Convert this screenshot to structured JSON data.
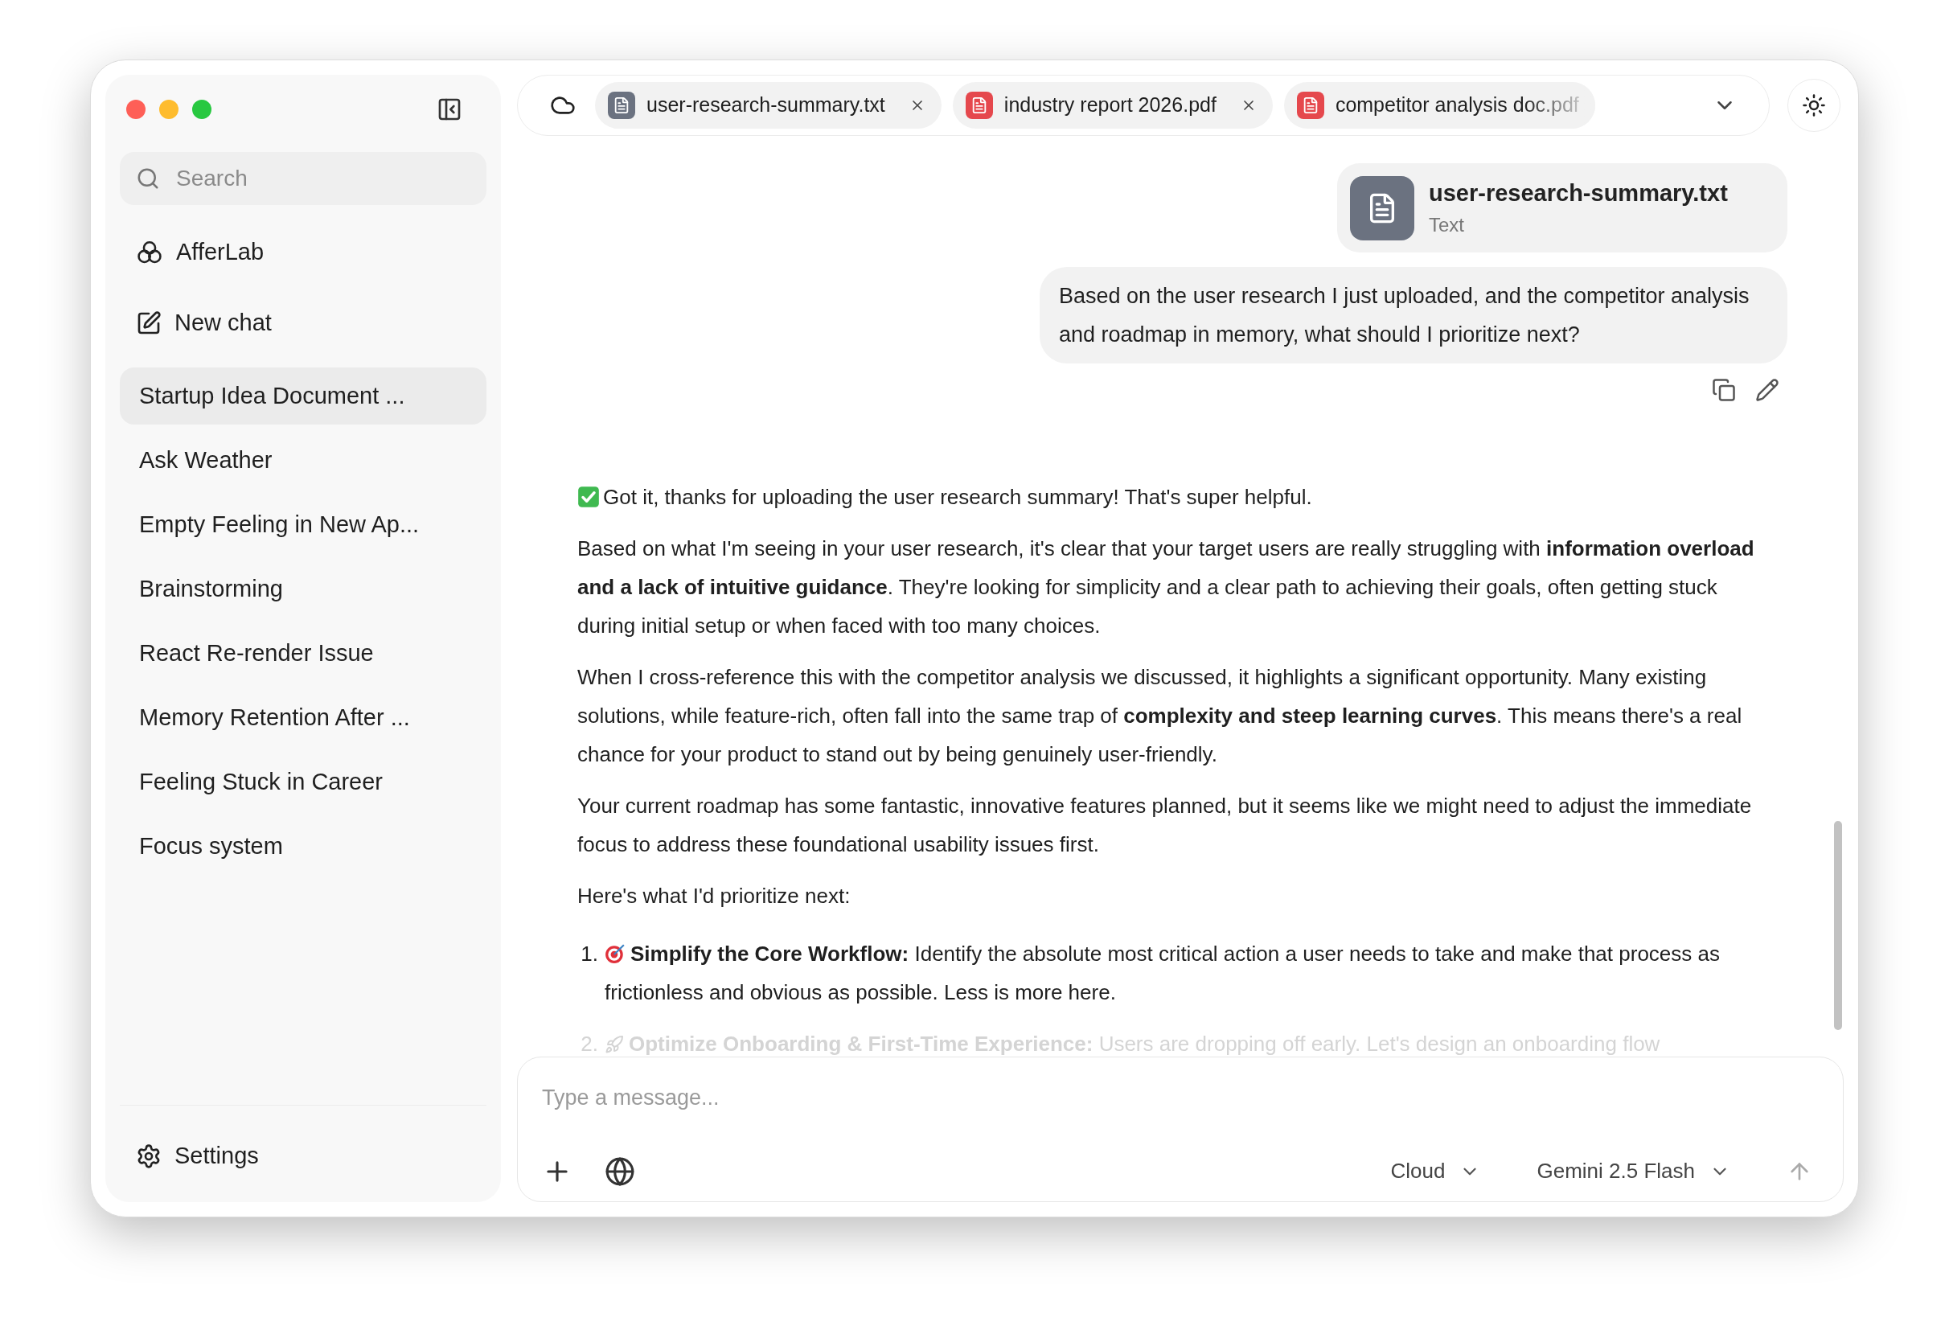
{
  "sidebar": {
    "search": {
      "placeholder": "Search"
    },
    "nav": [
      {
        "kind": "workspace",
        "label": "AfferLab"
      },
      {
        "kind": "new_chat",
        "label": "New chat"
      }
    ],
    "chats": [
      {
        "label": "Startup Idea Document ...",
        "selected": true
      },
      {
        "label": "Ask Weather",
        "selected": false
      },
      {
        "label": "Empty Feeling in New Ap...",
        "selected": false
      },
      {
        "label": "Brainstorming",
        "selected": false
      },
      {
        "label": "React Re-render Issue",
        "selected": false
      },
      {
        "label": "Memory Retention After ...",
        "selected": false
      },
      {
        "label": "Feeling Stuck in Career",
        "selected": false
      },
      {
        "label": "Focus system",
        "selected": false
      }
    ],
    "settings": {
      "label": "Settings"
    }
  },
  "tabs": [
    {
      "name": "user-research-summary.txt",
      "kind": "text",
      "closable": true,
      "truncated": false
    },
    {
      "name": "industry report 2026.pdf",
      "kind": "pdf",
      "closable": true,
      "truncated": false
    },
    {
      "name": "competitor analysis doc.pdf",
      "kind": "pdf",
      "closable": false,
      "truncated": true
    }
  ],
  "conversation": {
    "attachment": {
      "name": "user-research-summary.txt",
      "type_label": "Text"
    },
    "user_message": "Based on the user research I just uploaded, and the competitor analysis and roadmap in memory, what should I prioritize next?",
    "reply": {
      "paragraphs": [
        {
          "kind": "status",
          "text": "Got it, thanks for uploading the user research summary! That's super helpful."
        },
        {
          "kind": "plain",
          "text": "Based on what I'm seeing in your user research, it's clear that your target users are really struggling with **information overload and a lack of intuitive guidance**. They're looking for simplicity and a clear path to achieving their goals, often getting stuck during initial setup or when faced with too many choices."
        },
        {
          "kind": "plain",
          "text": "When I cross-reference this with the competitor analysis we discussed, it highlights a significant opportunity. Many existing solutions, while feature-rich, often fall into the same trap of **complexity and steep learning curves**. This means there's a real chance for your product to stand out by being genuinely user-friendly."
        },
        {
          "kind": "plain",
          "text": "Your current roadmap has some fantastic, innovative features planned, but it seems like we might need to adjust the immediate focus to address these foundational usability issues first."
        },
        {
          "kind": "plain",
          "text": "Here's what I'd prioritize next:"
        }
      ],
      "list": [
        {
          "number": "1.",
          "text": "**Simplify the Core Workflow:** Identify the absolute most critical action a user needs to take and make that process as frictionless and obvious as possible. Less is more here.",
          "faded": false
        },
        {
          "number": "2.",
          "text": "**Optimize Onboarding & First-Time Experience:** Users are dropping off early. Let's design an onboarding flow",
          "faded": true
        }
      ]
    }
  },
  "composer": {
    "placeholder": "Type a message...",
    "selectors": [
      {
        "label": "Cloud"
      },
      {
        "label": "Gemini 2.5 Flash"
      }
    ]
  }
}
